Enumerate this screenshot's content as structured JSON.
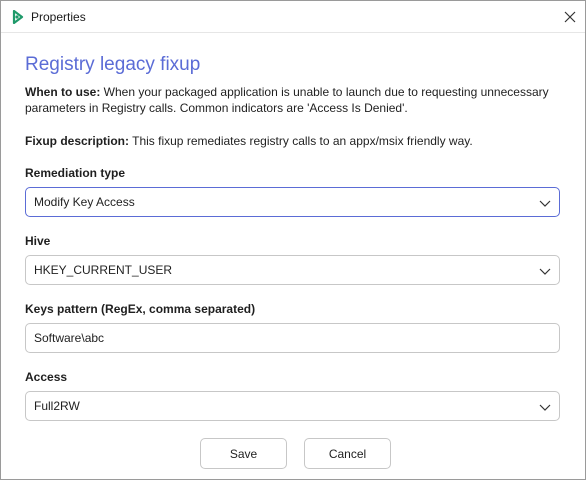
{
  "window": {
    "title": "Properties",
    "accent": "#5b6cd6"
  },
  "content": {
    "heading": "Registry legacy fixup",
    "when_label": "When to use:",
    "when_text": " When your packaged application is unable to launch due to requesting unnecessary parameters in Registry calls. Common indicators are 'Access Is Denied'.",
    "fixup_label": "Fixup description:",
    "fixup_text": " This fixup remediates registry calls to an appx/msix friendly way."
  },
  "fields": {
    "remediation": {
      "label": "Remediation type",
      "value": "Modify Key Access"
    },
    "hive": {
      "label": "Hive",
      "value": "HKEY_CURRENT_USER"
    },
    "keys": {
      "label": "Keys pattern (RegEx, comma separated)",
      "value": "Software\\abc"
    },
    "access": {
      "label": "Access",
      "value": "Full2RW"
    }
  },
  "buttons": {
    "save": "Save",
    "cancel": "Cancel"
  },
  "icons": {
    "app": "app-logo-icon",
    "close": "close-icon",
    "dropdown": "chevron-down-icon"
  }
}
